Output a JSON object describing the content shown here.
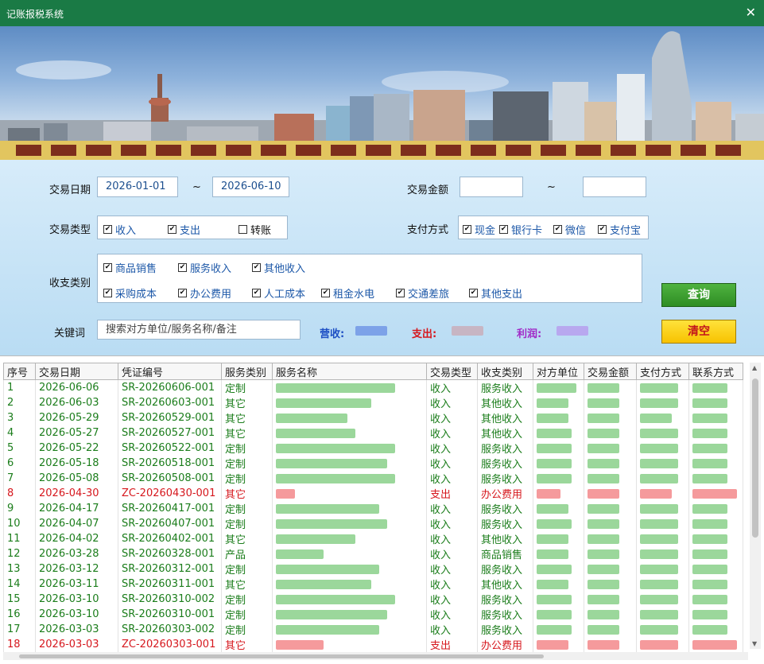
{
  "window": {
    "title": "记账报税系统",
    "close_icon": "close-icon"
  },
  "filters": {
    "date_label": "交易日期",
    "date_from": "2026-01-01",
    "date_sep": "~",
    "date_to": "2026-06-10",
    "amount_label": "交易金额",
    "amount_sep": "~",
    "amount_from": "",
    "amount_to": "",
    "type_label": "交易类型",
    "types": [
      {
        "label": "收入",
        "checked": true
      },
      {
        "label": "支出",
        "checked": true
      },
      {
        "label": "转账",
        "checked": false
      }
    ],
    "payment_label": "支付方式",
    "payments": [
      {
        "label": "现金",
        "checked": true
      },
      {
        "label": "银行卡",
        "checked": true
      },
      {
        "label": "微信",
        "checked": true
      },
      {
        "label": "支付宝",
        "checked": true
      }
    ],
    "category_label": "收支类别",
    "categories_row1": [
      {
        "label": "商品销售",
        "checked": true
      },
      {
        "label": "服务收入",
        "checked": true
      },
      {
        "label": "其他收入",
        "checked": true
      }
    ],
    "categories_row2": [
      {
        "label": "采购成本",
        "checked": true
      },
      {
        "label": "办公费用",
        "checked": true
      },
      {
        "label": "人工成本",
        "checked": true
      },
      {
        "label": "租金水电",
        "checked": true
      },
      {
        "label": "交通差旅",
        "checked": true
      },
      {
        "label": "其他支出",
        "checked": true
      }
    ],
    "keyword_label": "关键词",
    "keyword_placeholder": "搜索对方单位/服务名称/备注",
    "revenue_label": "营收:",
    "expense_label": "支出:",
    "profit_label": "利润:",
    "query_button": "查询",
    "clear_button": "清空"
  },
  "colors": {
    "income": "#1b7d1b",
    "expense": "#d6171d",
    "titlebar": "#1a7a45"
  },
  "table": {
    "headers": [
      "序号",
      "交易日期",
      "凭证编号",
      "服务类别",
      "服务名称",
      "交易类型",
      "收支类别",
      "对方单位",
      "交易金额",
      "支付方式",
      "联系方式"
    ],
    "rows": [
      {
        "seq": "1",
        "date": "2026-06-06",
        "voucher": "SR-20260606-001",
        "service_type": "定制",
        "tx_type": "收入",
        "category": "服务收入",
        "kind": "inc"
      },
      {
        "seq": "2",
        "date": "2026-06-03",
        "voucher": "SR-20260603-001",
        "service_type": "其它",
        "tx_type": "收入",
        "category": "其他收入",
        "kind": "inc"
      },
      {
        "seq": "3",
        "date": "2026-05-29",
        "voucher": "SR-20260529-001",
        "service_type": "其它",
        "tx_type": "收入",
        "category": "其他收入",
        "kind": "inc"
      },
      {
        "seq": "4",
        "date": "2026-05-27",
        "voucher": "SR-20260527-001",
        "service_type": "其它",
        "tx_type": "收入",
        "category": "其他收入",
        "kind": "inc"
      },
      {
        "seq": "5",
        "date": "2026-05-22",
        "voucher": "SR-20260522-001",
        "service_type": "定制",
        "tx_type": "收入",
        "category": "服务收入",
        "kind": "inc"
      },
      {
        "seq": "6",
        "date": "2026-05-18",
        "voucher": "SR-20260518-001",
        "service_type": "定制",
        "tx_type": "收入",
        "category": "服务收入",
        "kind": "inc"
      },
      {
        "seq": "7",
        "date": "2026-05-08",
        "voucher": "SR-20260508-001",
        "service_type": "定制",
        "tx_type": "收入",
        "category": "服务收入",
        "kind": "inc"
      },
      {
        "seq": "8",
        "date": "2026-04-30",
        "voucher": "ZC-20260430-001",
        "service_type": "其它",
        "tx_type": "支出",
        "category": "办公费用",
        "kind": "exp"
      },
      {
        "seq": "9",
        "date": "2026-04-17",
        "voucher": "SR-20260417-001",
        "service_type": "定制",
        "tx_type": "收入",
        "category": "服务收入",
        "kind": "inc"
      },
      {
        "seq": "10",
        "date": "2026-04-07",
        "voucher": "SR-20260407-001",
        "service_type": "定制",
        "tx_type": "收入",
        "category": "服务收入",
        "kind": "inc"
      },
      {
        "seq": "11",
        "date": "2026-04-02",
        "voucher": "SR-20260402-001",
        "service_type": "其它",
        "tx_type": "收入",
        "category": "其他收入",
        "kind": "inc"
      },
      {
        "seq": "12",
        "date": "2026-03-28",
        "voucher": "SR-20260328-001",
        "service_type": "产品",
        "tx_type": "收入",
        "category": "商品销售",
        "kind": "inc"
      },
      {
        "seq": "13",
        "date": "2026-03-12",
        "voucher": "SR-20260312-001",
        "service_type": "定制",
        "tx_type": "收入",
        "category": "服务收入",
        "kind": "inc"
      },
      {
        "seq": "14",
        "date": "2026-03-11",
        "voucher": "SR-20260311-001",
        "service_type": "其它",
        "tx_type": "收入",
        "category": "其他收入",
        "kind": "inc"
      },
      {
        "seq": "15",
        "date": "2026-03-10",
        "voucher": "SR-20260310-002",
        "service_type": "定制",
        "tx_type": "收入",
        "category": "服务收入",
        "kind": "inc"
      },
      {
        "seq": "16",
        "date": "2026-03-10",
        "voucher": "SR-20260310-001",
        "service_type": "定制",
        "tx_type": "收入",
        "category": "服务收入",
        "kind": "inc"
      },
      {
        "seq": "17",
        "date": "2026-03-03",
        "voucher": "SR-20260303-002",
        "service_type": "定制",
        "tx_type": "收入",
        "category": "服务收入",
        "kind": "inc"
      },
      {
        "seq": "18",
        "date": "2026-03-03",
        "voucher": "ZC-20260303-001",
        "service_type": "其它",
        "tx_type": "支出",
        "category": "办公费用",
        "kind": "exp"
      }
    ]
  }
}
